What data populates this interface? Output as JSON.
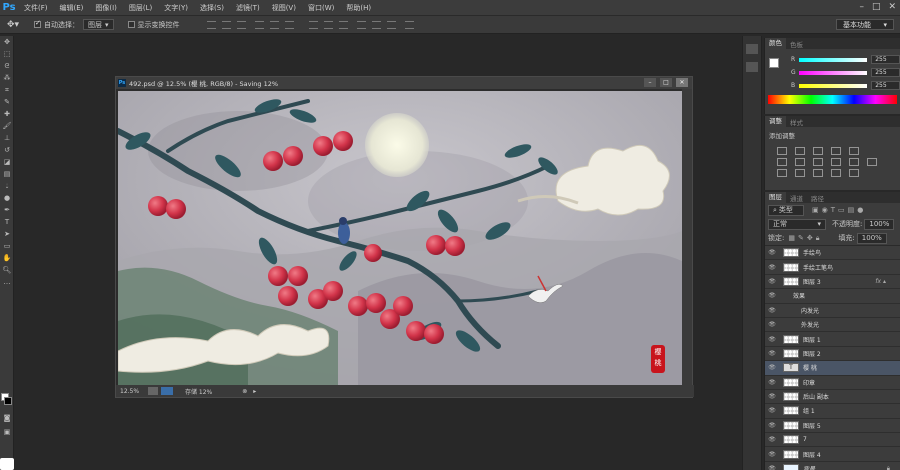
{
  "menubar": {
    "logo": "Ps",
    "items": [
      "文件(F)",
      "编辑(E)",
      "图像(I)",
      "图层(L)",
      "文字(Y)",
      "选择(S)",
      "滤镜(T)",
      "视图(V)",
      "窗口(W)",
      "帮助(H)"
    ]
  },
  "options": {
    "auto_select_label": "自动选择：",
    "auto_select_value": "图层",
    "show_transform_label": "显示变换控件",
    "workspace": "基本功能"
  },
  "document": {
    "title": "492.psd @ 12.5% (樱 桃, RGB/8) - Saving 12%",
    "zoom": "12.5%",
    "status_text": "存储 12%",
    "seal_text": "樱桃"
  },
  "color_panel": {
    "tabs": [
      "颜色",
      "色板"
    ],
    "channels": [
      {
        "label": "R",
        "value": "255",
        "gradient": "#00ffff"
      },
      {
        "label": "G",
        "value": "255",
        "gradient": "#ff00ff"
      },
      {
        "label": "B",
        "value": "255",
        "gradient": "#ffff00"
      }
    ]
  },
  "adjust_panel": {
    "tabs": [
      "调整",
      "样式"
    ],
    "heading": "添加调整"
  },
  "layers_panel": {
    "tabs": [
      "图层",
      "通道",
      "路径"
    ],
    "filter_label": "类型",
    "blend_mode": "正常",
    "opacity_label": "不透明度:",
    "opacity_value": "100%",
    "lock_label": "锁定:",
    "fill_label": "填充:",
    "fill_value": "100%",
    "layers": [
      {
        "name": "手绘鸟",
        "sub": false
      },
      {
        "name": "手绘工笔鸟",
        "sub": false
      },
      {
        "name": "图层 3",
        "sub": false,
        "fx": true
      },
      {
        "name": "效果",
        "sub": true
      },
      {
        "name": "内发光",
        "sub": true
      },
      {
        "name": "外发光",
        "sub": true
      },
      {
        "name": "图层 1",
        "sub": false
      },
      {
        "name": "图层 2",
        "sub": false
      },
      {
        "name": "樱 桃",
        "sub": false,
        "selected": true,
        "text": true
      },
      {
        "name": "印章",
        "sub": false
      },
      {
        "name": "后山 副本",
        "sub": false
      },
      {
        "name": "组 1",
        "sub": false
      },
      {
        "name": "图层 5",
        "sub": false
      },
      {
        "name": "7",
        "sub": false
      },
      {
        "name": "图层 4",
        "sub": false
      },
      {
        "name": "背景",
        "sub": false,
        "locked": true
      }
    ]
  }
}
